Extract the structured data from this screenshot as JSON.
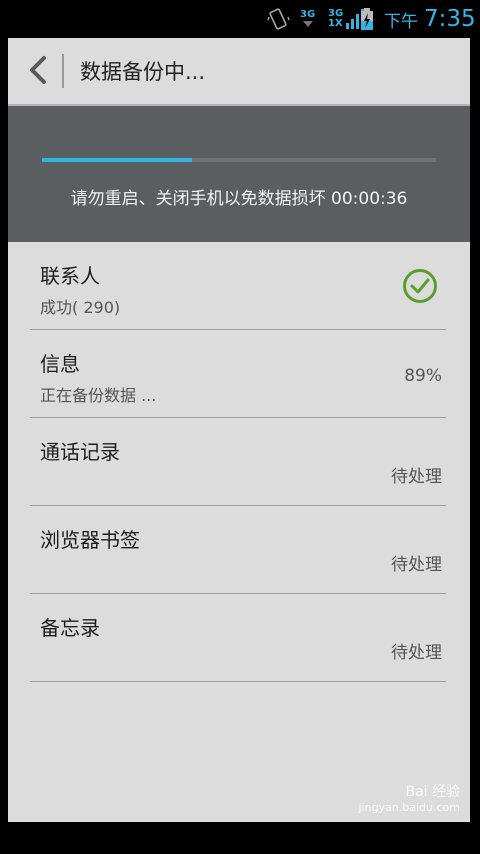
{
  "status_bar": {
    "network_a": "3G",
    "network_b": "3G",
    "network_b_sub": "1X",
    "ampm": "下午",
    "time": "7:35",
    "icons": [
      "vibrate-icon",
      "signal-icon",
      "battery-charging-icon"
    ]
  },
  "header": {
    "back_icon": "chevron-left-icon",
    "title": "数据备份中..."
  },
  "progress": {
    "fraction": 0.38,
    "message": "请勿重启、关闭手机以免数据损坏 00:00:36"
  },
  "items": [
    {
      "title": "联系人",
      "subtitle": "成功( 290)",
      "status": "",
      "status_icon": "check-circle-icon"
    },
    {
      "title": "信息",
      "subtitle": "正在备份数据 ...",
      "status": "89%"
    },
    {
      "title": "通话记录",
      "subtitle": "",
      "status": "待处理"
    },
    {
      "title": "浏览器书签",
      "subtitle": "",
      "status": "待处理"
    },
    {
      "title": "备忘录",
      "subtitle": "",
      "status": "待处理"
    }
  ],
  "watermark": {
    "line1": "Bai 经验",
    "line2": "jingyan.baidu.com"
  },
  "colors": {
    "accent": "#33b5e5",
    "success": "#5a9e2f",
    "panel": "#5b5e61"
  }
}
